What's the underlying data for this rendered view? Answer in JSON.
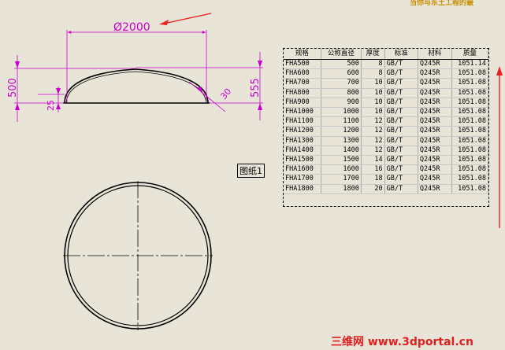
{
  "drawing": {
    "diameter_label": "Ø2000",
    "height_500": "500",
    "height_555": "555",
    "dim_25": "25",
    "dim_30": "30",
    "sheet_label": "图纸1"
  },
  "table": {
    "headers": [
      "规格",
      "公称直径",
      "厚度",
      "标准",
      "材料",
      "质量"
    ],
    "rows": [
      [
        "FHA500",
        "500",
        "8",
        "GB/T",
        "Q245R",
        "1051.14"
      ],
      [
        "FHA600",
        "600",
        "8",
        "GB/T",
        "Q245R",
        "1051.08"
      ],
      [
        "FHA700",
        "700",
        "10",
        "GB/T",
        "Q245R",
        "1051.08"
      ],
      [
        "FHA800",
        "800",
        "10",
        "GB/T",
        "Q245R",
        "1051.08"
      ],
      [
        "FHA900",
        "900",
        "10",
        "GB/T",
        "Q245R",
        "1051.08"
      ],
      [
        "FHA1000",
        "1000",
        "10",
        "GB/T",
        "Q245R",
        "1051.08"
      ],
      [
        "FHA1100",
        "1100",
        "12",
        "GB/T",
        "Q245R",
        "1051.08"
      ],
      [
        "FHA1200",
        "1200",
        "12",
        "GB/T",
        "Q245R",
        "1051.08"
      ],
      [
        "FHA1300",
        "1300",
        "12",
        "GB/T",
        "Q245R",
        "1051.08"
      ],
      [
        "FHA1400",
        "1400",
        "12",
        "GB/T",
        "Q245R",
        "1051.08"
      ],
      [
        "FHA1500",
        "1500",
        "14",
        "GB/T",
        "Q245R",
        "1051.08"
      ],
      [
        "FHA1600",
        "1600",
        "16",
        "GB/T",
        "Q245R",
        "1051.08"
      ],
      [
        "FHA1700",
        "1700",
        "18",
        "GB/T",
        "Q245R",
        "1051.08"
      ],
      [
        "FHA1800",
        "1800",
        "20",
        "GB/T",
        "Q245R",
        "1051.08"
      ]
    ]
  },
  "watermark": {
    "top": "当你与东土工程的最",
    "bottom": "三维网 www.3dportal.cn"
  },
  "colors": {
    "background": "#e8e4d8",
    "dimension": "#cc00cc",
    "arrow": "#ee2020",
    "outline": "#000000"
  }
}
